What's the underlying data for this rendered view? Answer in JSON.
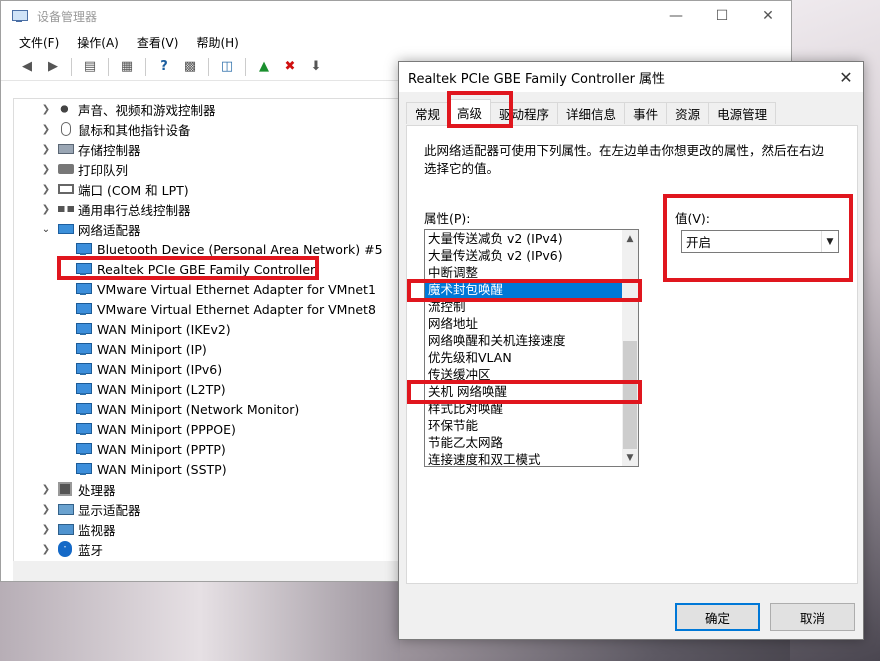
{
  "device_manager": {
    "title": "设备管理器",
    "menu": [
      "文件(F)",
      "操作(A)",
      "查看(V)",
      "帮助(H)"
    ],
    "tree": {
      "categories_before": [
        {
          "label": "声音、视频和游戏控制器",
          "icon": "speaker-icon"
        },
        {
          "label": "鼠标和其他指针设备",
          "icon": "mouse-icon"
        },
        {
          "label": "存储控制器",
          "icon": "storage-icon"
        },
        {
          "label": "打印队列",
          "icon": "printer-icon"
        },
        {
          "label": "端口 (COM 和 LPT)",
          "icon": "port-icon"
        },
        {
          "label": "通用串行总线控制器",
          "icon": "usb-icon"
        }
      ],
      "network_category": "网络适配器",
      "network_adapters": [
        "Bluetooth Device (Personal Area Network) #5",
        "Realtek PCIe GBE Family Controller",
        "VMware Virtual Ethernet Adapter for VMnet1",
        "VMware Virtual Ethernet Adapter for VMnet8",
        "WAN Miniport (IKEv2)",
        "WAN Miniport (IP)",
        "WAN Miniport (IPv6)",
        "WAN Miniport (L2TP)",
        "WAN Miniport (Network Monitor)",
        "WAN Miniport (PPPOE)",
        "WAN Miniport (PPTP)",
        "WAN Miniport (SSTP)"
      ],
      "categories_after": [
        {
          "label": "处理器",
          "icon": "processor-icon"
        },
        {
          "label": "显示适配器",
          "icon": "display-adapter-icon"
        },
        {
          "label": "监视器",
          "icon": "monitor-icon"
        },
        {
          "label": "蓝牙",
          "icon": "bluetooth-icon"
        }
      ]
    }
  },
  "dialog": {
    "title": "Realtek PCIe GBE Family Controller 属性",
    "tabs": [
      "常规",
      "高级",
      "驱动程序",
      "详细信息",
      "事件",
      "资源",
      "电源管理"
    ],
    "active_tab": "高级",
    "description": "此网络适配器可使用下列属性。在左边单击你想更改的属性，然后在右边选择它的值。",
    "property_label": "属性(P):",
    "value_label": "值(V):",
    "properties": [
      "大量传送减负 v2 (IPv4)",
      "大量传送减负 v2 (IPv6)",
      "中断调整",
      "魔术封包唤醒",
      "流控制",
      "网络地址",
      "网络唤醒和关机连接速度",
      "优先级和VLAN",
      "传送缓冲区",
      "关机 网络唤醒",
      "样式比对唤醒",
      "环保节能",
      "节能乙太网路",
      "连接速度和双工模式"
    ],
    "selected_property": "魔术封包唤醒",
    "value": "开启",
    "ok_label": "确定",
    "cancel_label": "取消"
  },
  "colors": {
    "highlight_box": "#e0161e",
    "selection": "#0078d7"
  }
}
